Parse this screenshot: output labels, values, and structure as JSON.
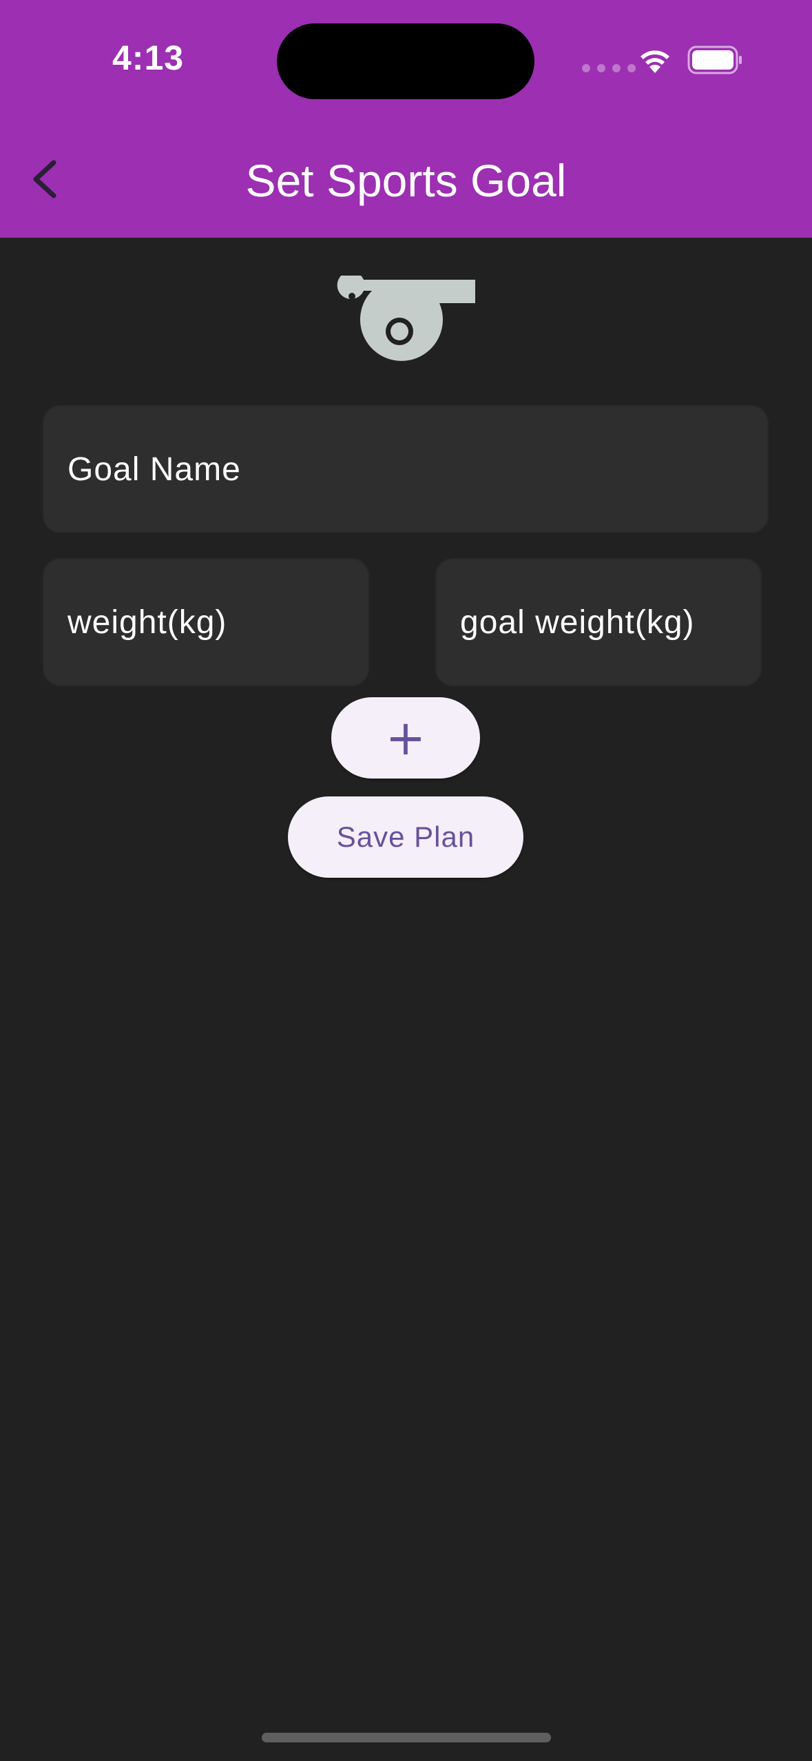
{
  "status_bar": {
    "time": "4:13",
    "icons": [
      "cellular-signal-icon",
      "wifi-icon",
      "battery-icon"
    ]
  },
  "header": {
    "title": "Set Sports Goal",
    "back_icon": "chevron-left-icon",
    "background_color": "#9c2fb2"
  },
  "hero_icon": "whistle-icon",
  "form": {
    "goal_name": {
      "placeholder": "Goal Name",
      "value": ""
    },
    "weight": {
      "placeholder": "weight(kg)",
      "value": ""
    },
    "goal_weight": {
      "placeholder": "goal weight(kg)",
      "value": ""
    },
    "add_label": "+",
    "save_label": "Save Plan"
  },
  "colors": {
    "background": "#212121",
    "field": "#2e2e2e",
    "button": "#f4eff8",
    "button_text": "#66529b",
    "icon": "#c5cdcb"
  }
}
